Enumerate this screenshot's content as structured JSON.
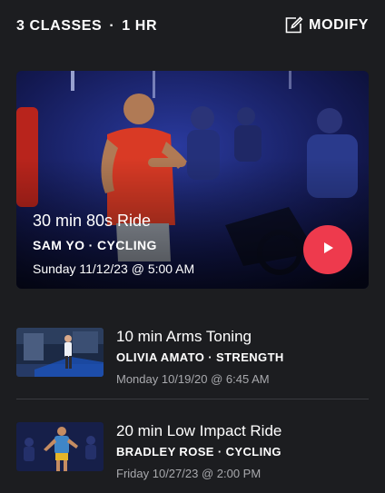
{
  "header": {
    "class_count": "3 CLASSES",
    "separator": "·",
    "duration": "1 HR",
    "modify_label": "MODIFY",
    "modify_icon": "edit-icon"
  },
  "featured": {
    "title": "30 min 80s Ride",
    "subtitle": "SAM YO · CYCLING",
    "date": "Sunday 11/12/23 @ 5:00 AM",
    "play_icon": "play-icon",
    "play_color": "#ee3a4d"
  },
  "classes": [
    {
      "title": "10 min Arms Toning",
      "subtitle": "OLIVIA AMATO · STRENGTH",
      "date": "Monday 10/19/20 @ 6:45 AM"
    },
    {
      "title": "20 min Low Impact Ride",
      "subtitle": "BRADLEY ROSE · CYCLING",
      "date": "Friday 10/27/23 @ 2:00 PM"
    }
  ]
}
